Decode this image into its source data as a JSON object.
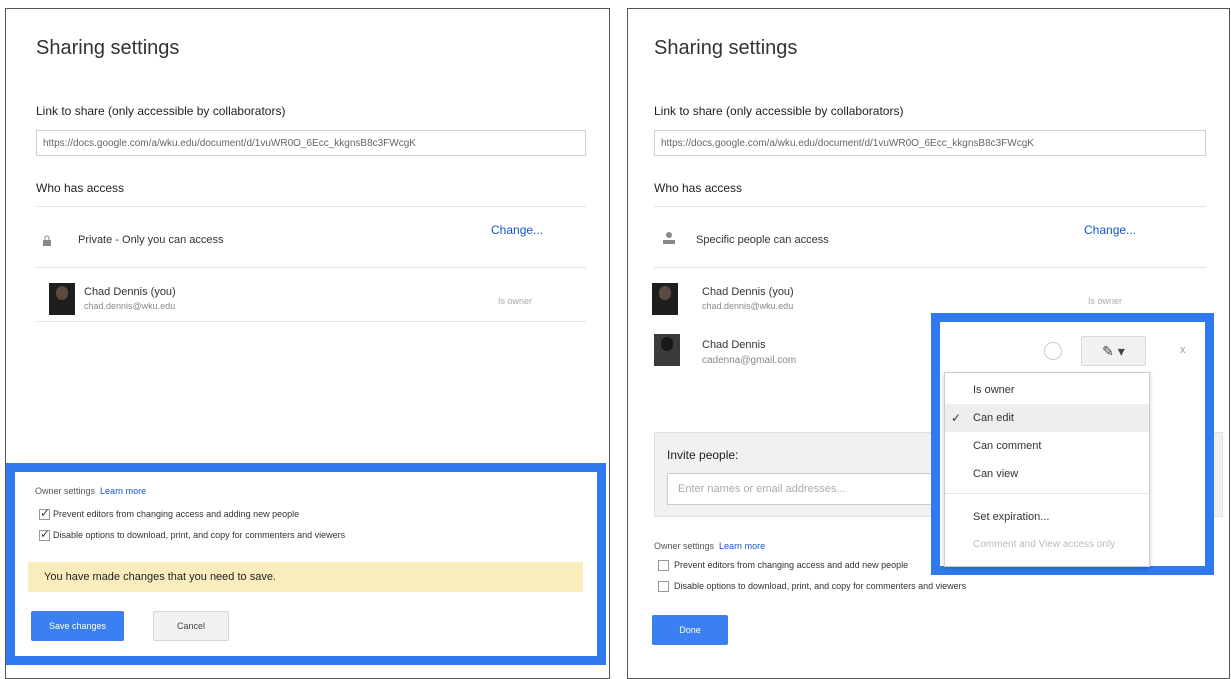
{
  "left": {
    "title": "Sharing settings",
    "link_label": "Link to share (only accessible by collaborators)",
    "link_value": "https://docs.google.com/a/wku.edu/document/d/1vuWR0O_6Ecc_kkgnsB8c3FWcgK",
    "who_has_access": "Who has access",
    "access_icon": "lock-icon",
    "access_text": "Private - Only you can access",
    "change_link": "Change...",
    "person": {
      "name": "Chad Dennis (you)",
      "email": "chad.dennis@wku.edu",
      "role": "Is owner"
    },
    "owner_settings_label": "Owner settings",
    "learn_more": "Learn more",
    "option1": "Prevent editors from changing access and adding new people",
    "option2": "Disable options to download, print, and copy for commenters and viewers",
    "warning": "You have made changes that you need to save.",
    "save_button": "Save changes",
    "cancel_button": "Cancel"
  },
  "right": {
    "title": "Sharing settings",
    "link_label": "Link to share (only accessible by collaborators)",
    "link_value": "https://docs.google.com/a/wku.edu/document/d/1vuWR0O_6Ecc_kkgnsB8c3FWcgK",
    "who_has_access": "Who has access",
    "access_icon": "people-icon",
    "access_text": "Specific people can access",
    "change_link": "Change...",
    "person1": {
      "name": "Chad Dennis (you)",
      "email": "chad.dennis@wku.edu",
      "role": "Is owner"
    },
    "person2": {
      "name": "Chad Dennis",
      "email": "cadenna@gmail.com"
    },
    "close_mark": "x",
    "invite_label": "Invite people:",
    "invite_placeholder": "Enter names or email addresses...",
    "owner_settings_label": "Owner settings",
    "learn_more": "Learn more",
    "option1": "Prevent editors from changing access and add new people",
    "option2": "Disable options to download, print, and copy for commenters and viewers",
    "done_button": "Done",
    "menu": {
      "items": [
        "Is owner",
        "Can edit",
        "Can comment",
        "Can view",
        "Set expiration...",
        "Comment and View access only"
      ],
      "selected_index": 1
    }
  },
  "colors": {
    "highlight": "#2f7aef",
    "primary_button": "#3b7ff0",
    "warning_bg": "#f9edbe",
    "link": "#1155cc"
  }
}
